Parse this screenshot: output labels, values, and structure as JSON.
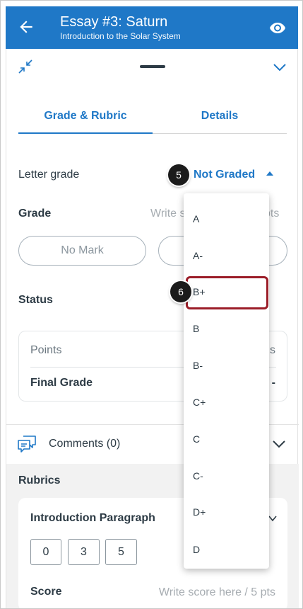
{
  "header": {
    "title": "Essay #3: Saturn",
    "subtitle": "Introduction to the Solar System",
    "back_icon": "arrow-left-icon",
    "view_icon": "eye-icon",
    "background": "#1f78c7"
  },
  "tabs": [
    {
      "label": "Grade & Rubric",
      "active": true
    },
    {
      "label": "Details",
      "active": false
    }
  ],
  "letter_grade": {
    "label": "Letter grade",
    "value": "Not Graded"
  },
  "grade": {
    "label": "Grade",
    "placeholder_visible": "Write s",
    "pts_visible": "pts"
  },
  "grade_buttons": {
    "no_mark": "No Mark",
    "excused_visible": ""
  },
  "status": {
    "label": "Status"
  },
  "summary_card": {
    "points_label": "Points",
    "points_value_visible": "s",
    "final_grade_label": "Final Grade",
    "final_grade_value": "-"
  },
  "comments": {
    "label": "Comments (0)"
  },
  "rubrics": {
    "title": "Rubrics",
    "criterion": "Introduction Paragraph",
    "ratings": [
      "0",
      "3",
      "5"
    ],
    "score_label": "Score",
    "score_placeholder": "Write score here  / 5 pts"
  },
  "dropdown": {
    "options": [
      "A",
      "A-",
      "B+",
      "B",
      "B-",
      "C+",
      "C",
      "C-",
      "D+",
      "D"
    ],
    "highlighted": "B+"
  },
  "callouts": {
    "step_5": "5",
    "step_6": "6"
  },
  "colors": {
    "accent": "#1f78c7",
    "highlight_border": "#9b1d28",
    "text": "#2d3b45"
  }
}
